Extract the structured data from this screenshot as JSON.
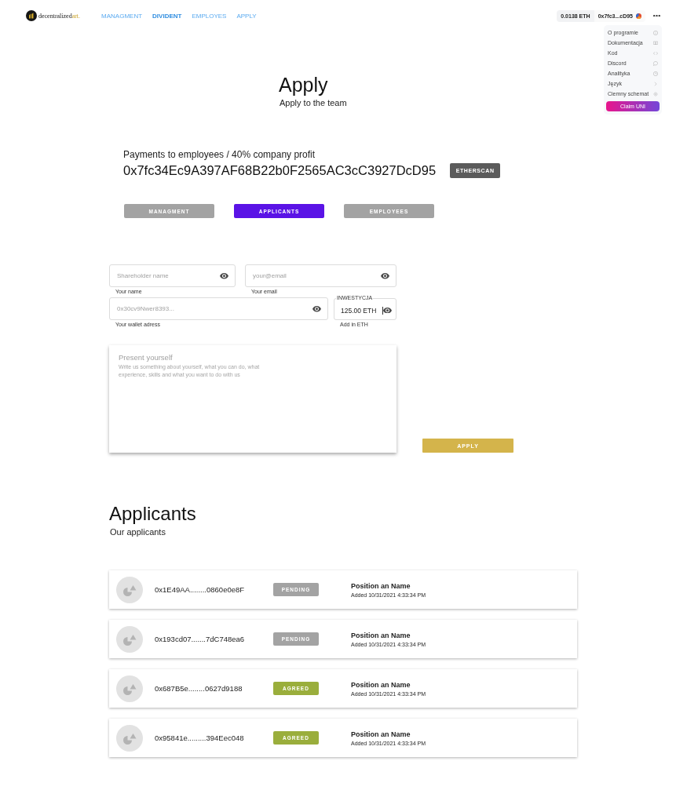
{
  "header": {
    "logo": {
      "text": "decentralized",
      "accent": "art."
    },
    "nav": [
      {
        "label": "MANAGMENT",
        "selected": false
      },
      {
        "label": "DIVIDENT",
        "selected": true
      },
      {
        "label": "EMPLOYES",
        "selected": false
      },
      {
        "label": "APPLY",
        "selected": false
      }
    ],
    "balance": "0.0138 ETH",
    "account": "0x7fc3...cD95"
  },
  "menu": {
    "items": [
      "O programie",
      "Dokumentacja",
      "Kod",
      "Discord",
      "Analityka",
      "Język",
      "Ciemny schemat"
    ],
    "claim_button": "Claim UNI"
  },
  "heading": {
    "title": "Apply",
    "subtitle": "Apply to the team"
  },
  "contract": {
    "caption": "Payments to employees / 40% company profit",
    "address": "0x7fc34Ec9A397AF68B22b0F2565AC3cC3927DcD95",
    "button": "ETHERSCAN"
  },
  "tabs": [
    {
      "label": "MANAGMENT",
      "selected": false
    },
    {
      "label": "APPLICANTS",
      "selected": true
    },
    {
      "label": "EMPLOYEES",
      "selected": false
    }
  ],
  "form": {
    "fields": [
      {
        "kind": "text",
        "placeholder": "Shareholder name",
        "helper": "Your name"
      },
      {
        "kind": "text",
        "placeholder": "your@email",
        "helper": "Your email"
      },
      {
        "kind": "text",
        "placeholder": "0x30cv9Nwer8393...",
        "helper": "Your wallet adress"
      },
      {
        "kind": "amount",
        "label": "INWESTYCJA",
        "value": "125.00 ETH",
        "helper": "Add in ETH"
      }
    ],
    "message": {
      "title_placeholder": "Present yourself",
      "placeholder": "Write us something about yourself, what you can do, what experience, skills and what you want to do with us"
    },
    "submit": "APPLY"
  },
  "applicants": {
    "title": "Applicants",
    "subtitle": "Our applicants",
    "rows": [
      {
        "address": "0x1E49AA........0860e0e8F",
        "status": {
          "label": "PENDING",
          "kind": "pending"
        },
        "position": "Position an Name",
        "added": "Added 10/31/2021 4:33:34 PM"
      },
      {
        "address": "0x193cd07.......7dC748ea6",
        "status": {
          "label": "PENDING",
          "kind": "pending"
        },
        "position": "Position an Name",
        "added": "Added 10/31/2021 4:33:34 PM"
      },
      {
        "address": "0x687B5e........0627d9188",
        "status": {
          "label": "AGREED",
          "kind": "agreed"
        },
        "position": "Position an Name",
        "added": "Added 10/31/2021 4:33:34 PM"
      },
      {
        "address": "0x95841e.........394Eec048",
        "status": {
          "label": "AGREED",
          "kind": "agreed"
        },
        "position": "Position an Name",
        "added": "Added 10/31/2021 4:33:34 PM"
      }
    ]
  }
}
